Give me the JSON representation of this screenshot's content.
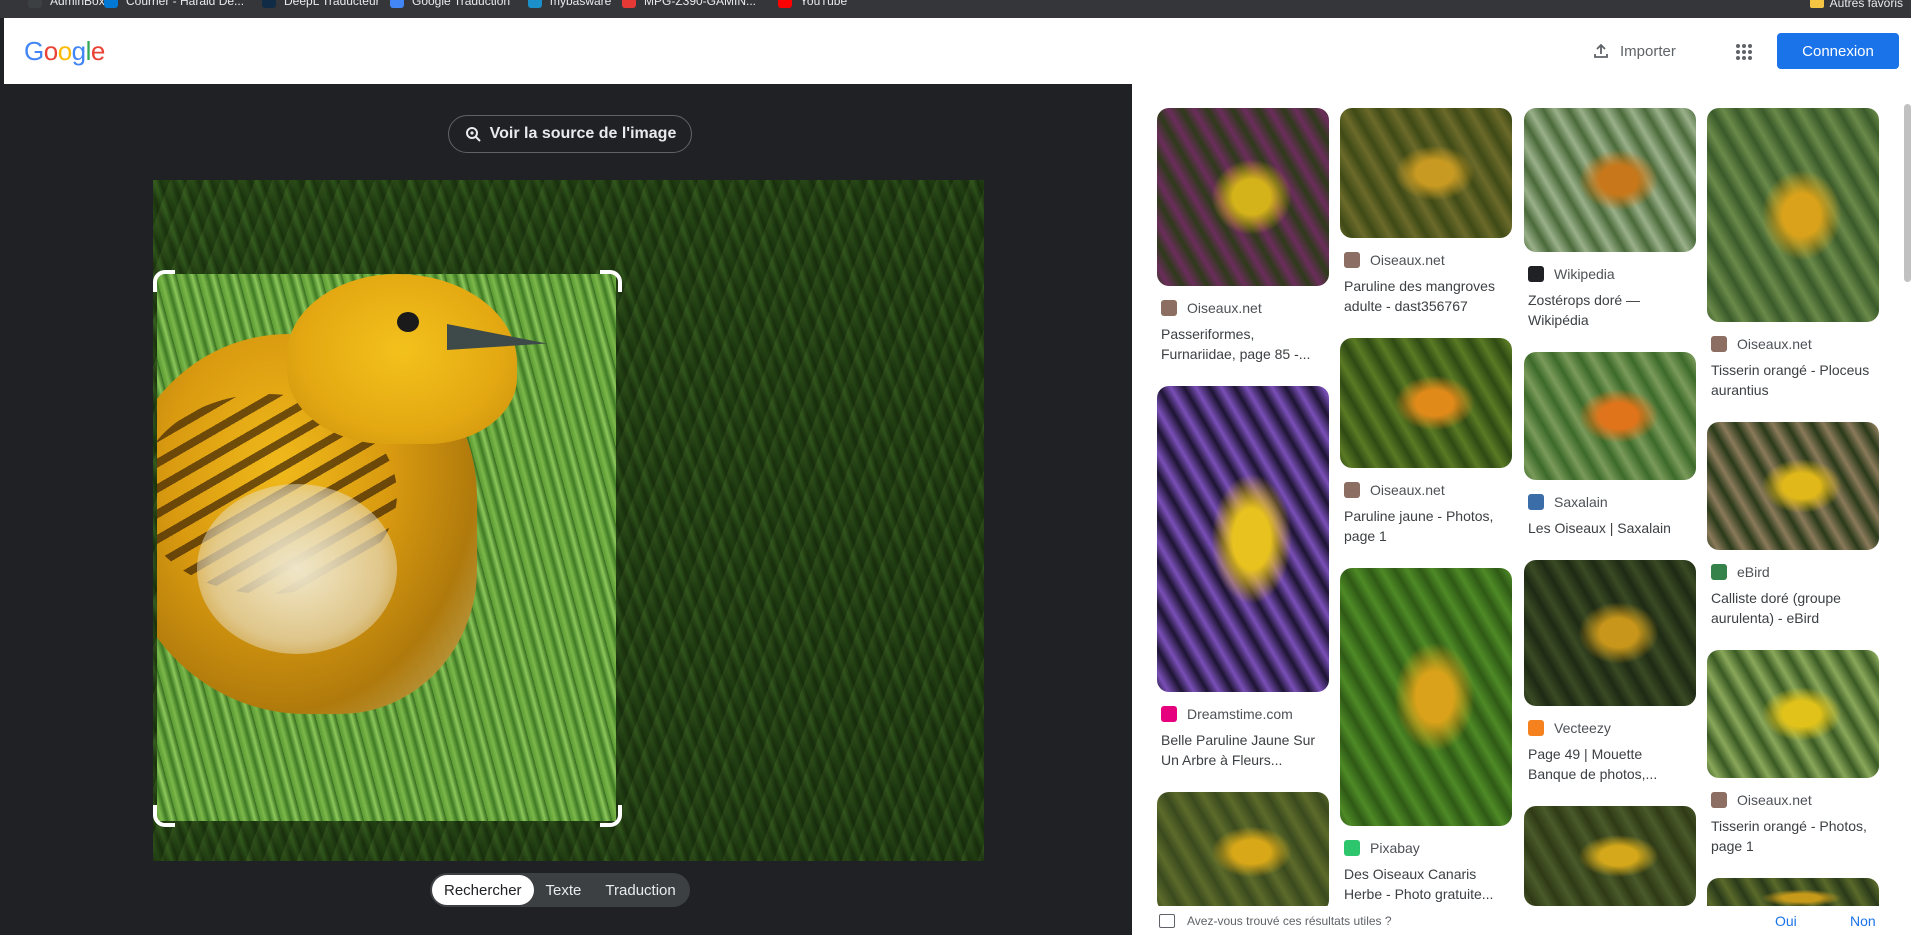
{
  "bookmarks": [
    {
      "label": "AdminBox",
      "color": "#3c4043"
    },
    {
      "label": "Courrier - Harald De...",
      "color": "#0078d4"
    },
    {
      "label": "DeepL Traducteur",
      "color": "#0f2b46"
    },
    {
      "label": "Google Traduction",
      "color": "#4285f4"
    },
    {
      "label": "mybasware",
      "color": "#1a8fc9"
    },
    {
      "label": "MPG-Z390-GAMIN...",
      "color": "#e53935"
    },
    {
      "label": "YouTube",
      "color": "#ff0000"
    }
  ],
  "bookmarks_right": "Autres favoris",
  "header": {
    "logo_letters": [
      "G",
      "o",
      "o",
      "g",
      "l",
      "e"
    ],
    "logo_colors": [
      "#4285f4",
      "#ea4335",
      "#fbbc05",
      "#4285f4",
      "#34a853",
      "#ea4335"
    ],
    "import_label": "Importer",
    "login_label": "Connexion",
    "accent": "#1a73e8"
  },
  "viewer": {
    "source_button": "Voir la source de l'image",
    "tabs": [
      "Rechercher",
      "Texte",
      "Traduction"
    ],
    "active_tab": "Rechercher"
  },
  "results": {
    "columns": [
      [
        {
          "source": "Oiseaux.net",
          "title": "Passeriformes, Furnariidae, page 85 -...",
          "icon": "bird-favicon",
          "icon_color": "#8d6e63",
          "thumb": [
            "#2e3a1a",
            "#d4b21a",
            "#6b2d5c"
          ]
        },
        {
          "source": "Dreamstime.com",
          "title": "Belle Paruline Jaune Sur Un Arbre à Fleurs...",
          "icon": "dreamstime-favicon",
          "icon_color": "#e6007e",
          "thumb": [
            "#1d1432",
            "#e8c21e",
            "#7a4fb8"
          ]
        },
        {
          "source": "",
          "title": "",
          "icon": "",
          "icon_color": "",
          "thumb": [
            "#3b4a1e",
            "#d9a818",
            "#5c6b2a"
          ]
        }
      ],
      [
        {
          "source": "Oiseaux.net",
          "title": "Paruline des mangroves adulte - dast356767",
          "icon": "bird-favicon",
          "icon_color": "#8d6e63",
          "thumb": [
            "#6b6a2a",
            "#c89a22",
            "#3f4a16"
          ]
        },
        {
          "source": "Oiseaux.net",
          "title": "Paruline jaune - Photos, page 1",
          "icon": "bird-favicon",
          "icon_color": "#8d6e63",
          "thumb": [
            "#2f4a14",
            "#e08a1a",
            "#5a7a24"
          ]
        },
        {
          "source": "Pixabay",
          "title": "Des Oiseaux Canaris Herbe - Photo gratuite...",
          "icon": "pixabay-favicon",
          "icon_color": "#2ec66d",
          "thumb": [
            "#2f5a16",
            "#d9a21a",
            "#4e8a26"
          ]
        }
      ],
      [
        {
          "source": "Wikipedia",
          "title": "Zostérops doré — Wikipédia",
          "icon": "wikipedia-favicon",
          "icon_color": "#202124",
          "thumb": [
            "#4a6a3a",
            "#c8781a",
            "#9ab08a"
          ]
        },
        {
          "source": "Saxalain",
          "title": "Les Oiseaux | Saxalain",
          "icon": "saxalain-favicon",
          "icon_color": "#3b6ea8",
          "thumb": [
            "#3c6a2a",
            "#e0741a",
            "#7a9a5a"
          ]
        },
        {
          "source": "Vecteezy",
          "title": "Page 49 | Mouette Banque de photos,...",
          "icon": "vecteezy-favicon",
          "icon_color": "#f5821f",
          "thumb": [
            "#1e2a14",
            "#c8961a",
            "#3a4a24"
          ]
        },
        {
          "source": "",
          "title": "",
          "icon": "",
          "icon_color": "",
          "thumb": [
            "#4a5a2a",
            "#d4a81a",
            "#2f3a16"
          ]
        }
      ],
      [
        {
          "source": "Oiseaux.net",
          "title": "Tisserin orangé - Ploceus aurantius",
          "icon": "bird-favicon",
          "icon_color": "#8d6e63",
          "thumb": [
            "#3a5a2a",
            "#d9a21a",
            "#6a8a4a"
          ]
        },
        {
          "source": "eBird",
          "title": "Calliste doré (groupe aurulenta) - eBird",
          "icon": "ebird-favicon",
          "icon_color": "#36824b",
          "thumb": [
            "#2a3a1a",
            "#e0b81a",
            "#8a7a5a"
          ]
        },
        {
          "source": "Oiseaux.net",
          "title": "Tisserin orangé - Photos, page 1",
          "icon": "bird-favicon",
          "icon_color": "#8d6e63",
          "thumb": [
            "#3a5a24",
            "#e0c21a",
            "#8aa85a"
          ]
        },
        {
          "source": "",
          "title": "",
          "icon": "",
          "icon_color": "",
          "thumb": [
            "#2a3a1a",
            "#c89a1a",
            "#5a6a2a"
          ]
        }
      ]
    ]
  },
  "feedback": {
    "question": "Avez-vous trouvé ces résultats utiles ?",
    "yes": "Oui",
    "no": "Non"
  }
}
